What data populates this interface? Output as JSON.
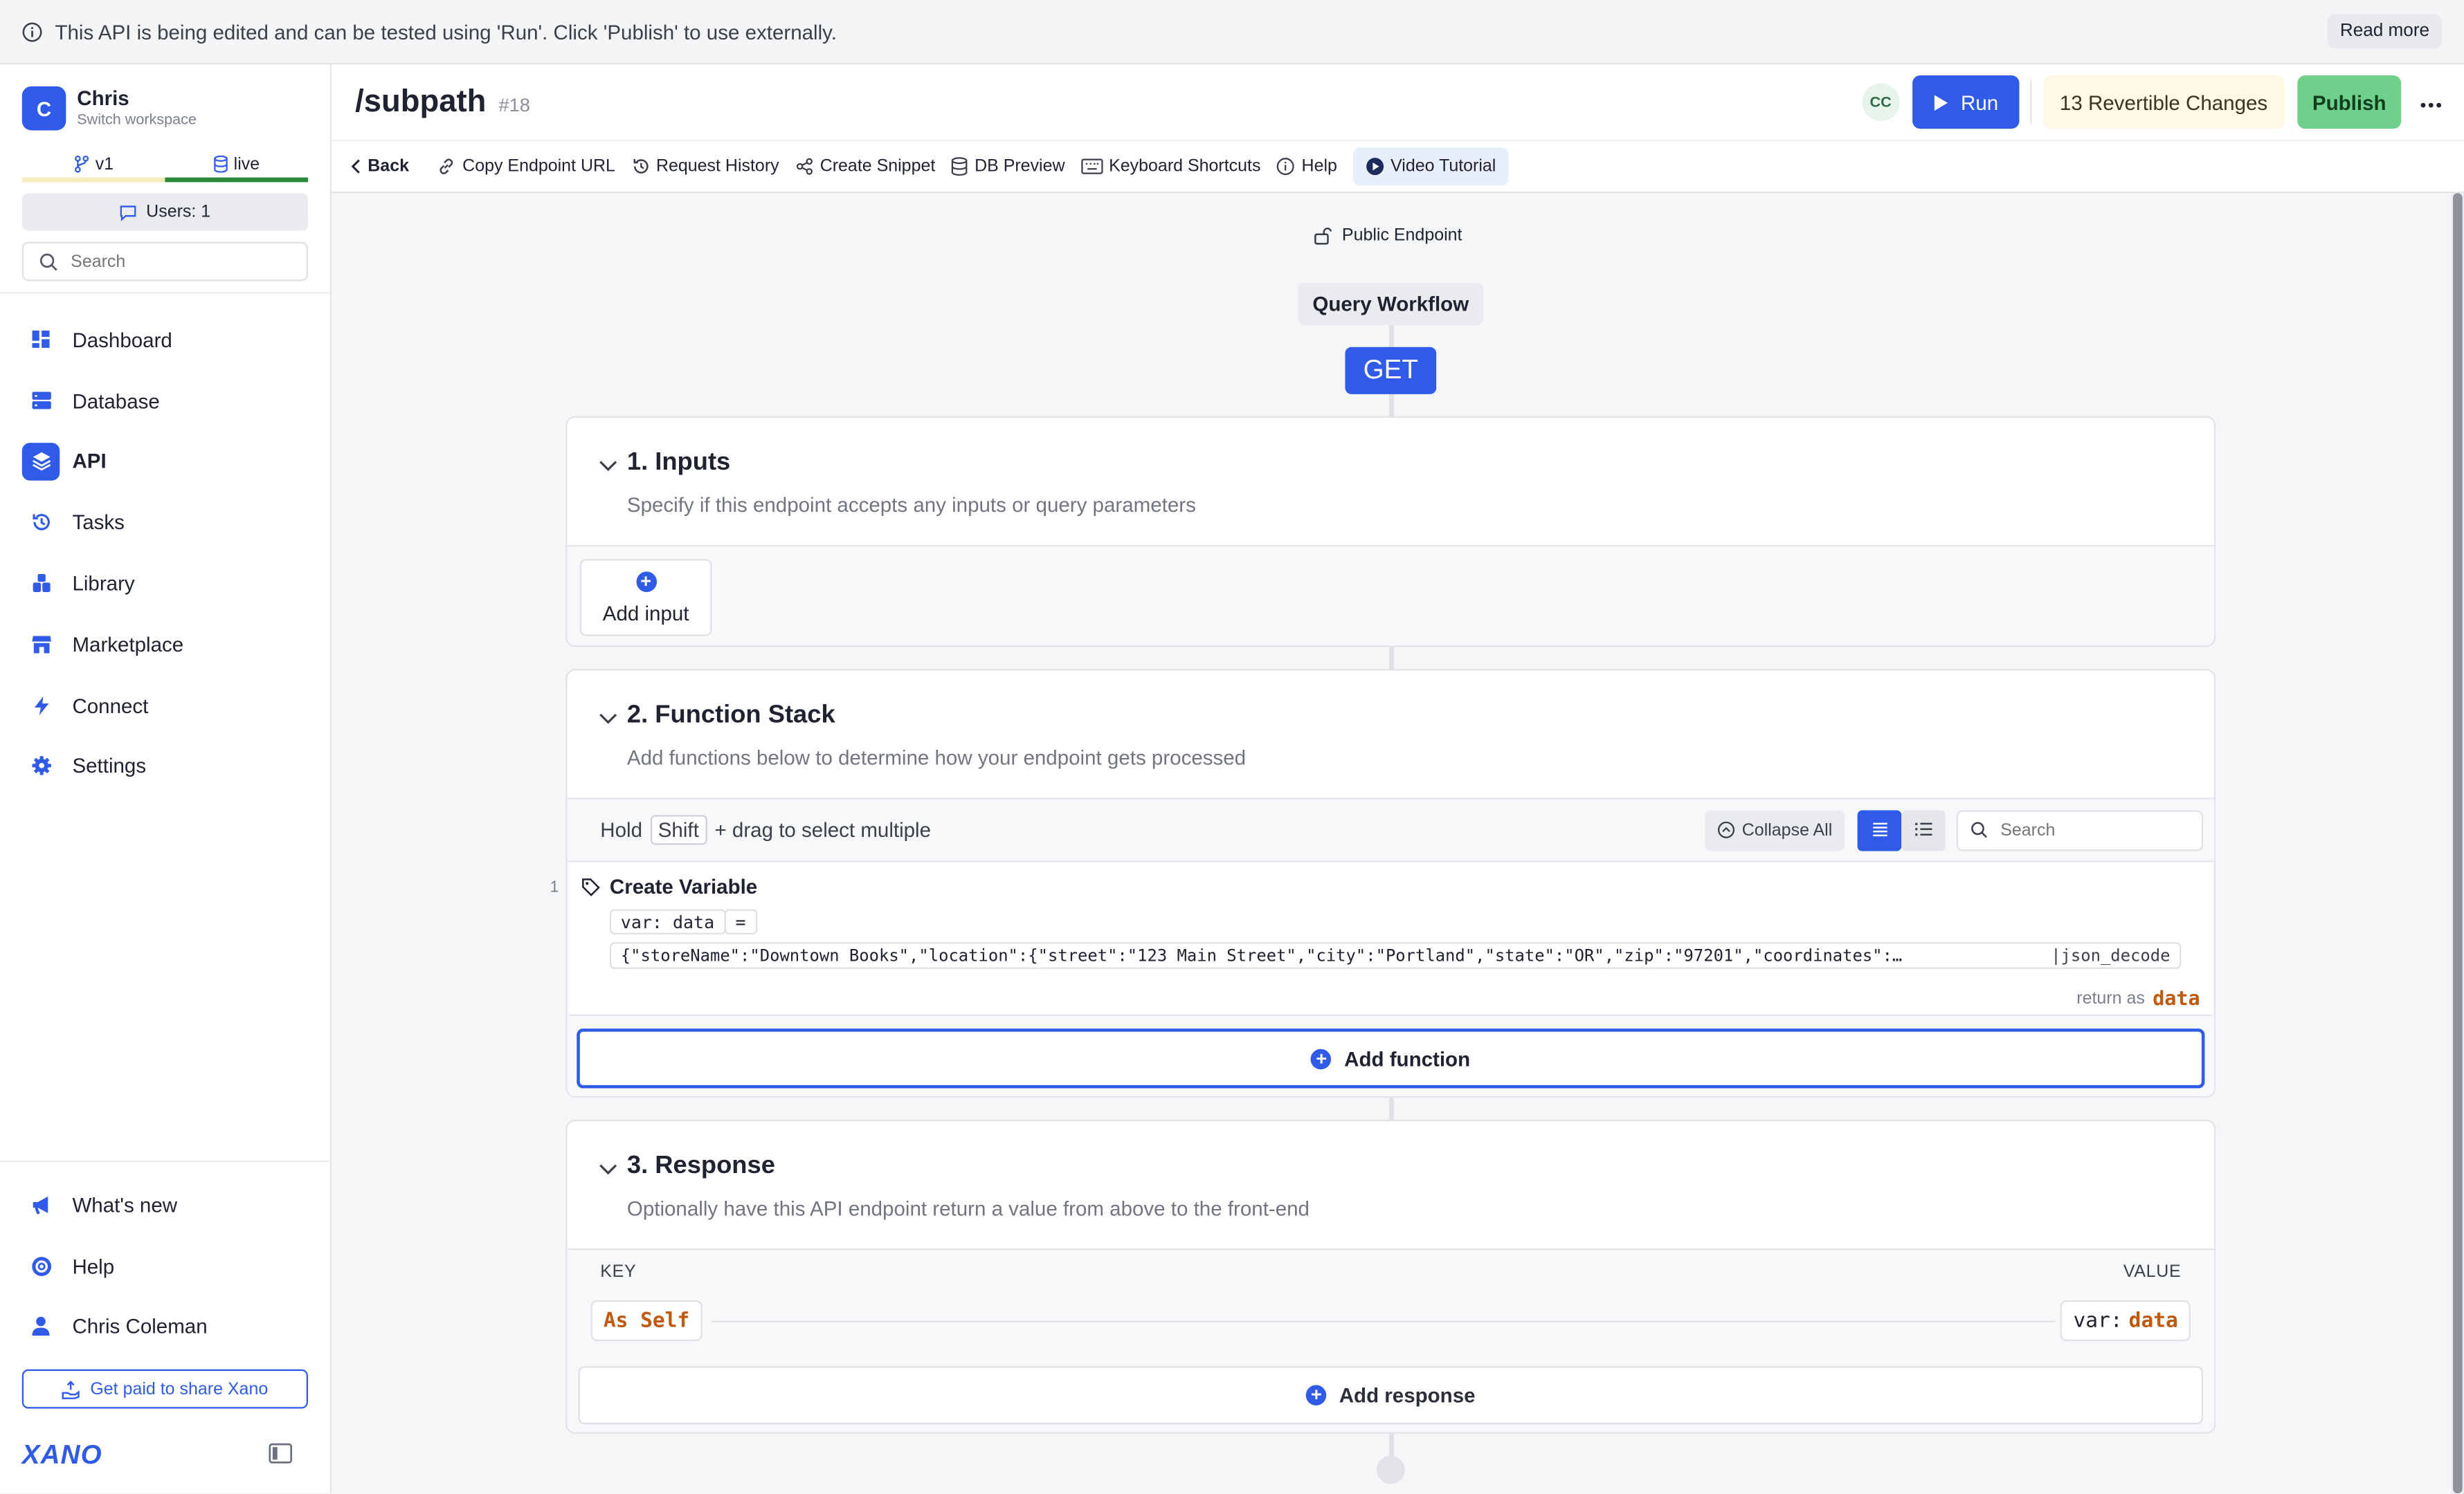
{
  "banner": {
    "text": "This API is being edited and can be tested using 'Run'. Click 'Publish' to use externally.",
    "read_more": "Read more"
  },
  "workspace": {
    "initial": "C",
    "name": "Chris",
    "sub": "Switch workspace"
  },
  "branch": {
    "version": "v1",
    "data_source": "live"
  },
  "users": "Users: 1",
  "sidebar_search_placeholder": "Search",
  "nav": [
    {
      "label": "Dashboard",
      "icon": "dashboard-icon"
    },
    {
      "label": "Database",
      "icon": "database-icon"
    },
    {
      "label": "API",
      "icon": "api-layers-icon",
      "active": true
    },
    {
      "label": "Tasks",
      "icon": "tasks-history-icon"
    },
    {
      "label": "Library",
      "icon": "library-icon"
    },
    {
      "label": "Marketplace",
      "icon": "marketplace-icon"
    },
    {
      "label": "Connect",
      "icon": "lightning-icon"
    },
    {
      "label": "Settings",
      "icon": "gear-icon"
    }
  ],
  "bottom_nav": [
    {
      "label": "What's new",
      "icon": "megaphone-icon"
    },
    {
      "label": "Help",
      "icon": "lifebuoy-icon"
    },
    {
      "label": "Chris Coleman",
      "icon": "user-icon"
    }
  ],
  "get_paid": "Get paid to share Xano",
  "logo": "XANO",
  "header": {
    "title": "/subpath",
    "id": "#18",
    "avatar": "CC",
    "run": "Run",
    "changes": "13 Revertible Changes",
    "publish": "Publish"
  },
  "toolbar": {
    "back": "Back",
    "copy_url": "Copy Endpoint URL",
    "history": "Request History",
    "snippet": "Create Snippet",
    "db_preview": "DB Preview",
    "shortcuts": "Keyboard Shortcuts",
    "help": "Help",
    "video": "Video Tutorial"
  },
  "workflow": {
    "public": "Public Endpoint",
    "label": "Query Workflow",
    "method": "GET"
  },
  "inputs": {
    "title": "1. Inputs",
    "subtitle": "Specify if this endpoint accepts any inputs or query parameters",
    "add": "Add input"
  },
  "stack": {
    "title": "2. Function Stack",
    "subtitle": "Add functions below to determine how your endpoint gets processed",
    "hold": "Hold",
    "shift": "Shift",
    "drag": "+ drag to select multiple",
    "collapse_all": "Collapse All",
    "search_placeholder": "Search",
    "functions": [
      {
        "number": "1",
        "name": "Create Variable",
        "var": "var: data",
        "eq": "=",
        "value": "{\"storeName\":\"Downtown Books\",\"location\":{\"street\":\"123 Main Street\",\"city\":\"Portland\",\"state\":\"OR\",\"zip\":\"97201\",\"coordinates\":…",
        "filter": "|json_decode",
        "return_as": "return as",
        "return_var": "data"
      }
    ],
    "add_function": "Add function"
  },
  "response": {
    "title": "3. Response",
    "subtitle": "Optionally have this API endpoint return a value from above to the front-end",
    "key_header": "KEY",
    "value_header": "VALUE",
    "key": "As Self",
    "value_prefix": "var:",
    "value_var": "data",
    "add": "Add response"
  },
  "colors": {
    "accent": "#2f5be8",
    "publish": "#6fd08c",
    "var_orange": "#c0580e",
    "revert_bg": "#fff8e6"
  }
}
